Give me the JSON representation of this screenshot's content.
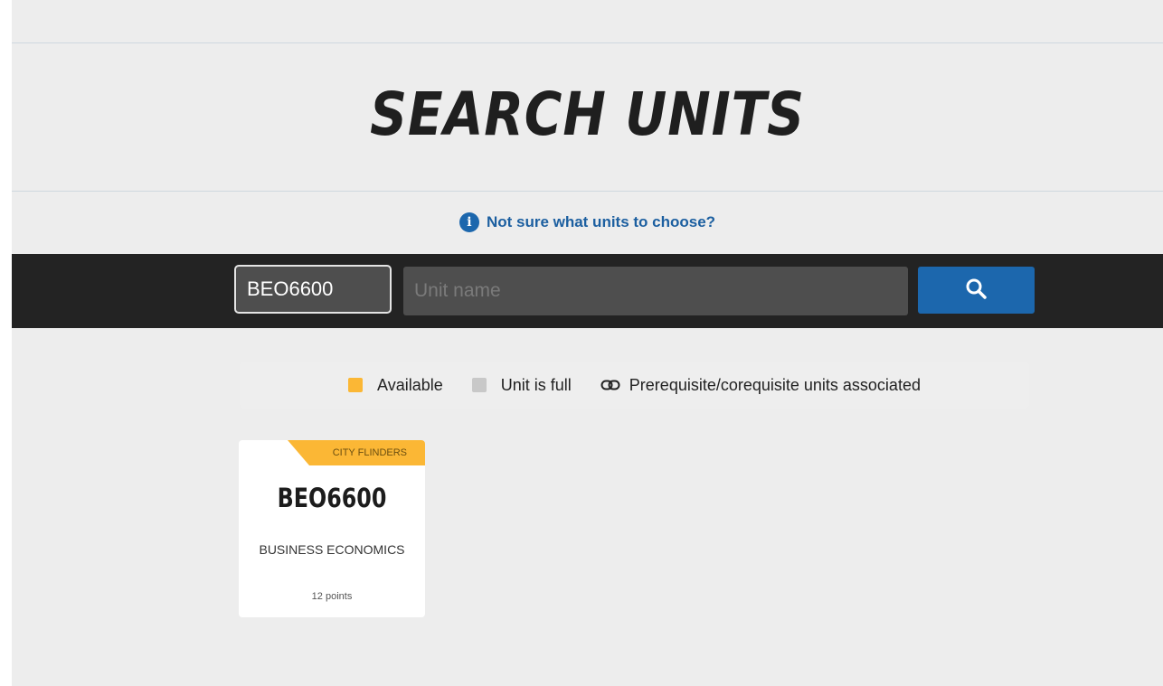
{
  "header": {
    "title": "SEARCH UNITS"
  },
  "help": {
    "text": "Not sure what units to choose?"
  },
  "search": {
    "code_value": "BEO6600",
    "name_placeholder": "Unit name",
    "button_icon": "search-icon"
  },
  "legend": {
    "available_label": "Available",
    "full_label": "Unit is full",
    "prereq_label": "Prerequisite/corequisite units associated"
  },
  "results": [
    {
      "campus": "CITY FLINDERS",
      "code": "BEO6600",
      "name": "BUSINESS ECONOMICS",
      "points": "12 points"
    }
  ],
  "colors": {
    "accent_blue": "#1c67ad",
    "available": "#fbb735",
    "full": "#c8c8c8",
    "bar": "#232323"
  }
}
